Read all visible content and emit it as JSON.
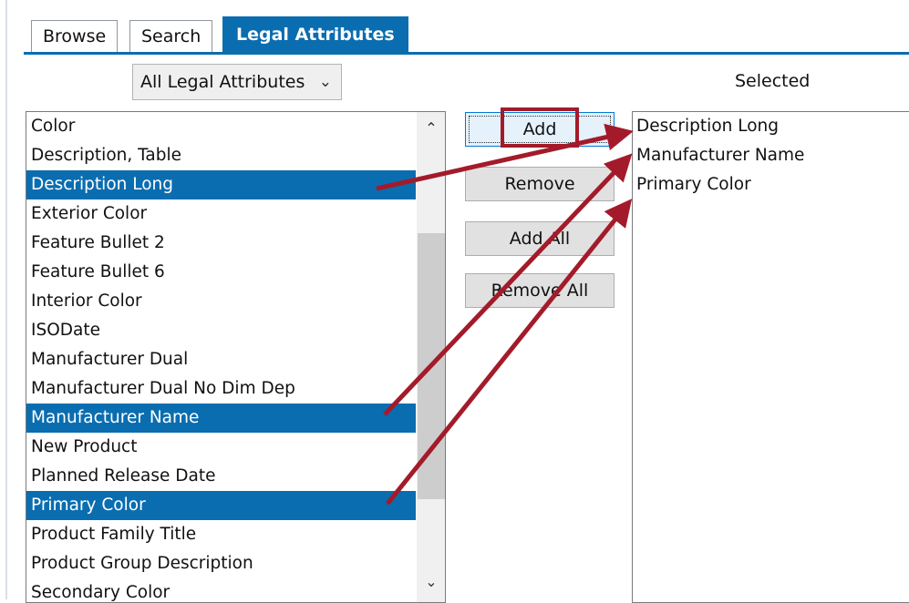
{
  "tabs": [
    {
      "label": "Browse",
      "active": false
    },
    {
      "label": "Search",
      "active": false
    },
    {
      "label": "Legal Attributes",
      "active": true
    }
  ],
  "filter": {
    "selected": "All Legal Attributes",
    "chevron_icon": "chevron-down-icon"
  },
  "selected_title": "Selected",
  "available": {
    "items": [
      {
        "label": "Color",
        "selected": false
      },
      {
        "label": "Description, Table",
        "selected": false
      },
      {
        "label": "Description Long",
        "selected": true
      },
      {
        "label": "Exterior Color",
        "selected": false
      },
      {
        "label": "Feature Bullet 2",
        "selected": false
      },
      {
        "label": "Feature Bullet 6",
        "selected": false
      },
      {
        "label": "Interior Color",
        "selected": false
      },
      {
        "label": "ISODate",
        "selected": false
      },
      {
        "label": "Manufacturer Dual",
        "selected": false
      },
      {
        "label": "Manufacturer Dual No Dim Dep",
        "selected": false
      },
      {
        "label": "Manufacturer Name",
        "selected": true
      },
      {
        "label": "New Product",
        "selected": false
      },
      {
        "label": "Planned Release Date",
        "selected": false
      },
      {
        "label": "Primary Color",
        "selected": true
      },
      {
        "label": "Product Family Title",
        "selected": false
      },
      {
        "label": "Product Group Description",
        "selected": false
      },
      {
        "label": "Secondary Color",
        "selected": false
      }
    ]
  },
  "buttons": {
    "add": "Add",
    "remove": "Remove",
    "add_all": "Add All",
    "remove_all": "Remove All"
  },
  "selected_list": {
    "items": [
      {
        "label": "Description Long"
      },
      {
        "label": "Manufacturer Name"
      },
      {
        "label": "Primary Color"
      }
    ]
  },
  "colors": {
    "accent": "#0a6db0",
    "annotation": "#a31b2a"
  }
}
